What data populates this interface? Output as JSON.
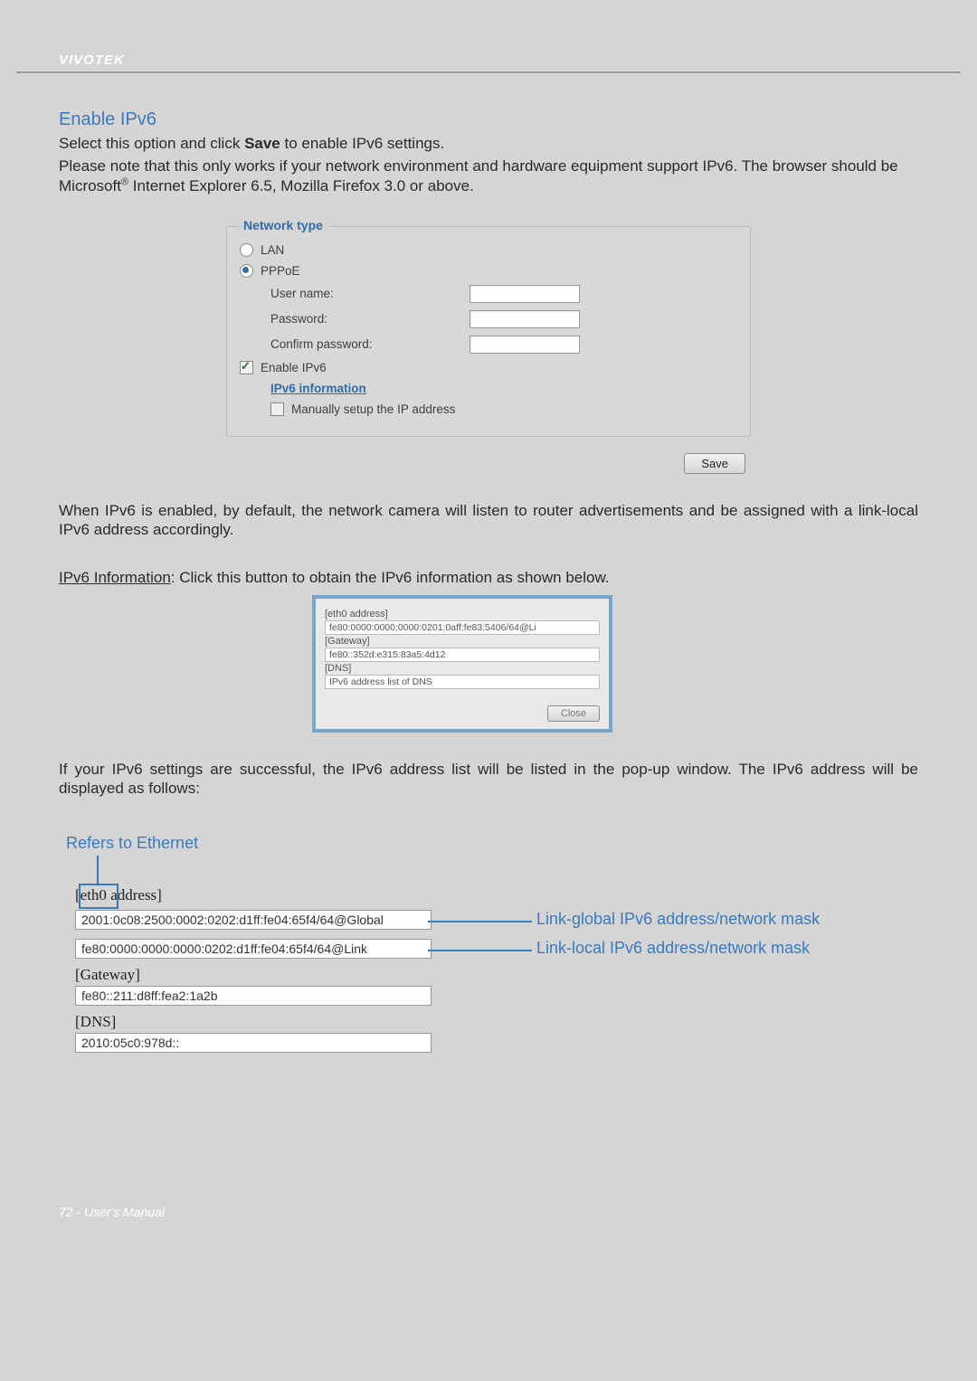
{
  "brand": "VIVOTEK",
  "section_title": "Enable IPv6",
  "intro_line1_pre": "Select this option and click ",
  "intro_line1_bold": "Save",
  "intro_line1_post": " to enable IPv6 settings.",
  "intro_line2": "Please note that this only works if your network environment and hardware equipment support IPv6. The browser should be Microsoft",
  "intro_line2_sup": "®",
  "intro_line2_post": " Internet Explorer 6.5, Mozilla Firefox 3.0 or above.",
  "panel": {
    "legend": "Network type",
    "lan": "LAN",
    "pppoe": "PPPoE",
    "username": "User name:",
    "password": "Password:",
    "confirm": "Confirm password:",
    "enable_ipv6": "Enable IPv6",
    "ipv6_info": "IPv6 information",
    "manual_ip": "Manually setup the IP address"
  },
  "save_btn": "Save",
  "after_panel": "When IPv6 is enabled, by default, the network camera will listen to router advertisements and be assigned with a link-local IPv6 address accordingly.",
  "ipv6_info_label": "IPv6 Information",
  "ipv6_info_text": ": Click this button to obtain the IPv6 information as shown below.",
  "popup": {
    "eth": "[eth0 address]",
    "eth_val": "fe80:0000:0000:0000:0201:0aff:fe83:5406/64@Li",
    "gw": "[Gateway]",
    "gw_val": "fe80::352d:e315:83a5:4d12",
    "dns": "[DNS]",
    "dns_val": "IPv6 address list of DNS",
    "close": "Close"
  },
  "after_popup": "If your IPv6 settings are successful, the IPv6 address list will be listed in the pop-up window. The IPv6 address will be displayed as follows:",
  "diagram": {
    "refers": "Refers to Ethernet",
    "eth_label_pre": "[eth0",
    "eth_label_post": " address]",
    "global": "2001:0c08:2500:0002:0202:d1ff:fe04:65f4/64@Global",
    "link": "fe80:0000:0000:0000:0202:d1ff:fe04:65f4/64@Link",
    "gateway_label": "[Gateway]",
    "gateway": "fe80::211:d8ff:fea2:1a2b",
    "dns_label": "[DNS]",
    "dns": "2010:05c0:978d::",
    "note_global": "Link-global IPv6 address/network mask",
    "note_local": "Link-local IPv6 address/network mask"
  },
  "footer": "72 - User's Manual"
}
